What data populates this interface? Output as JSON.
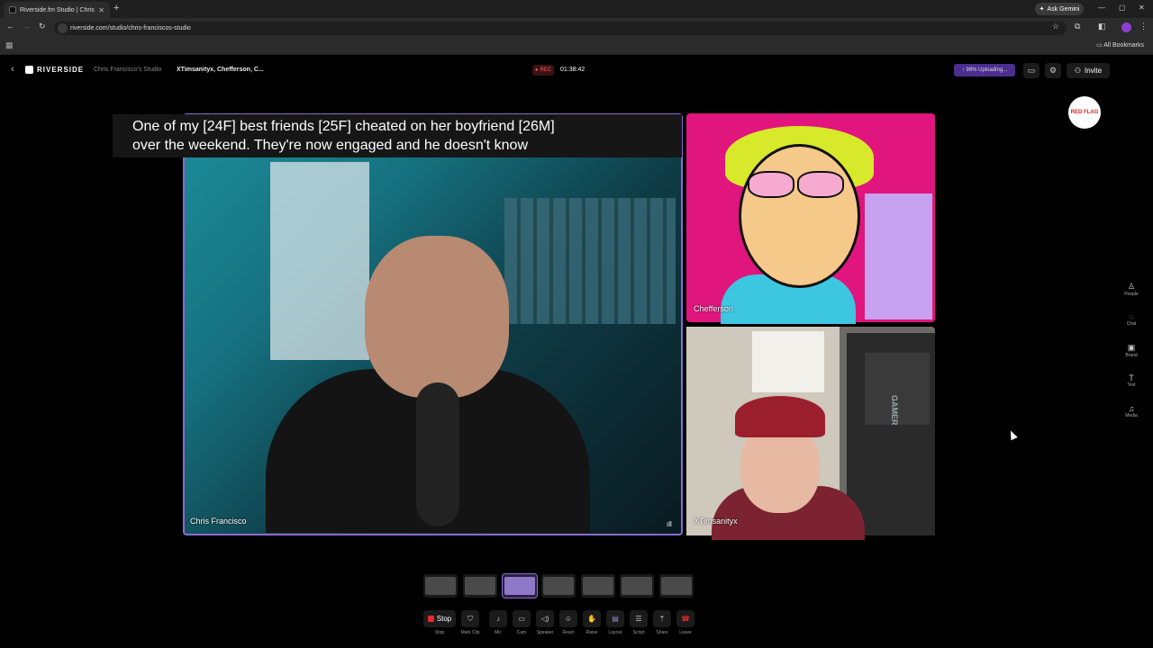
{
  "browser": {
    "tab_title": "Riverside.fm Studio | Chris",
    "tab_close": "✕",
    "new_tab": "+",
    "gemini": "Ask Gemini",
    "url": "riverside.com/studio/chris-franciscos-studio",
    "all_bookmarks": "All Bookmarks"
  },
  "header": {
    "back": "‹",
    "logo": "RIVERSIDE",
    "studio": "Chris Francisco's Studio",
    "participants": "XTimsanityx, Chefferson, C...",
    "rec": "REC",
    "timer": "01:38:42",
    "upload": "99% Uploading...",
    "invite": "Invite"
  },
  "badge": {
    "text": "RED FLAG"
  },
  "caption": {
    "line1": "One of my [24F] best friends [25F] cheated on her boyfriend [26M]",
    "line2": "over the weekend. They're now engaged and he doesn't know"
  },
  "tiles": {
    "main": "Chris Francisco",
    "top_right": "Chefferson",
    "bottom_right": "XTimsanityx",
    "gamer_text": "GAMER"
  },
  "rail": [
    {
      "label": "People",
      "icon": "people-icon",
      "glyph": "♙"
    },
    {
      "label": "Chat",
      "icon": "chat-icon",
      "glyph": "◌"
    },
    {
      "label": "Brand",
      "icon": "brand-icon",
      "glyph": "▣"
    },
    {
      "label": "Text",
      "icon": "text-icon",
      "glyph": "T"
    },
    {
      "label": "Media",
      "icon": "media-icon",
      "glyph": "♫"
    }
  ],
  "controls": {
    "stop": "Stop",
    "mark_clip": "Mark Clip",
    "mic": "Mic",
    "cam": "Cam",
    "speaker": "Speaker",
    "react": "React",
    "raise": "Raise",
    "layout": "Layout",
    "script": "Script",
    "share": "Share",
    "leave": "Leave"
  },
  "colors": {
    "accent": "#8b6ad0",
    "rec": "#e52a2a",
    "upload": "#4b2e8f"
  }
}
